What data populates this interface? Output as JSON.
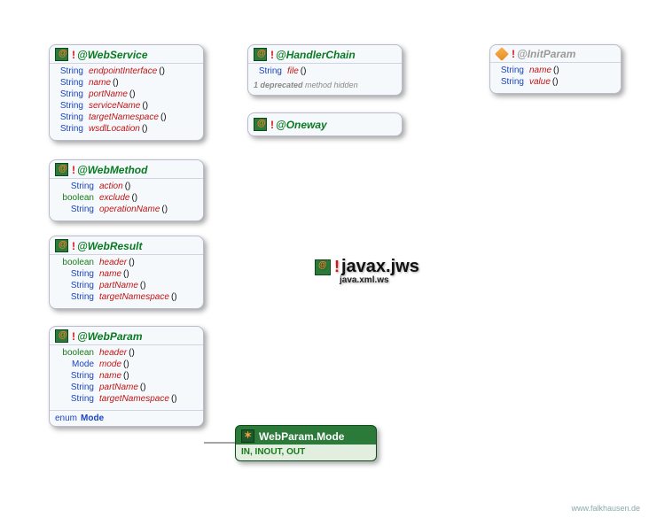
{
  "package": {
    "name": "javax.jws",
    "sub": "java.xml.ws"
  },
  "watermark": "www.falkhausen.de",
  "webservice": {
    "title": "@WebService",
    "members": [
      {
        "type": "String",
        "name": "endpointInterface",
        "p": "()"
      },
      {
        "type": "String",
        "name": "name",
        "p": "()"
      },
      {
        "type": "String",
        "name": "portName",
        "p": "()"
      },
      {
        "type": "String",
        "name": "serviceName",
        "p": "()"
      },
      {
        "type": "String",
        "name": "targetNamespace",
        "p": "()"
      },
      {
        "type": "String",
        "name": "wsdlLocation",
        "p": "()"
      }
    ]
  },
  "webmethod": {
    "title": "@WebMethod",
    "members": [
      {
        "type": "String",
        "name": "action",
        "p": "()"
      },
      {
        "type": "boolean",
        "name": "exclude",
        "p": "()"
      },
      {
        "type": "String",
        "name": "operationName",
        "p": "()"
      }
    ]
  },
  "webresult": {
    "title": "@WebResult",
    "members": [
      {
        "type": "boolean",
        "name": "header",
        "p": "()"
      },
      {
        "type": "String",
        "name": "name",
        "p": "()"
      },
      {
        "type": "String",
        "name": "partName",
        "p": "()"
      },
      {
        "type": "String",
        "name": "targetNamespace",
        "p": "()"
      }
    ]
  },
  "webparam": {
    "title": "@WebParam",
    "members": [
      {
        "type": "boolean",
        "name": "header",
        "p": "()"
      },
      {
        "type": "Mode",
        "name": "mode",
        "p": "()"
      },
      {
        "type": "String",
        "name": "name",
        "p": "()"
      },
      {
        "type": "String",
        "name": "partName",
        "p": "()"
      },
      {
        "type": "String",
        "name": "targetNamespace",
        "p": "()"
      }
    ],
    "enumLabel": "enum",
    "enumName": "Mode"
  },
  "handlerchain": {
    "title": "@HandlerChain",
    "members": [
      {
        "type": "String",
        "name": "file",
        "p": "()"
      }
    ],
    "deprecated_count": "1 deprecated",
    "deprecated_tail": " method hidden"
  },
  "oneway": {
    "title": "@Oneway"
  },
  "initparam": {
    "title": "@InitParam",
    "members": [
      {
        "type": "String",
        "name": "name",
        "p": "()"
      },
      {
        "type": "String",
        "name": "value",
        "p": "()"
      }
    ]
  },
  "webparammode": {
    "title": "WebParam.Mode",
    "values": "IN, INOUT, OUT"
  }
}
